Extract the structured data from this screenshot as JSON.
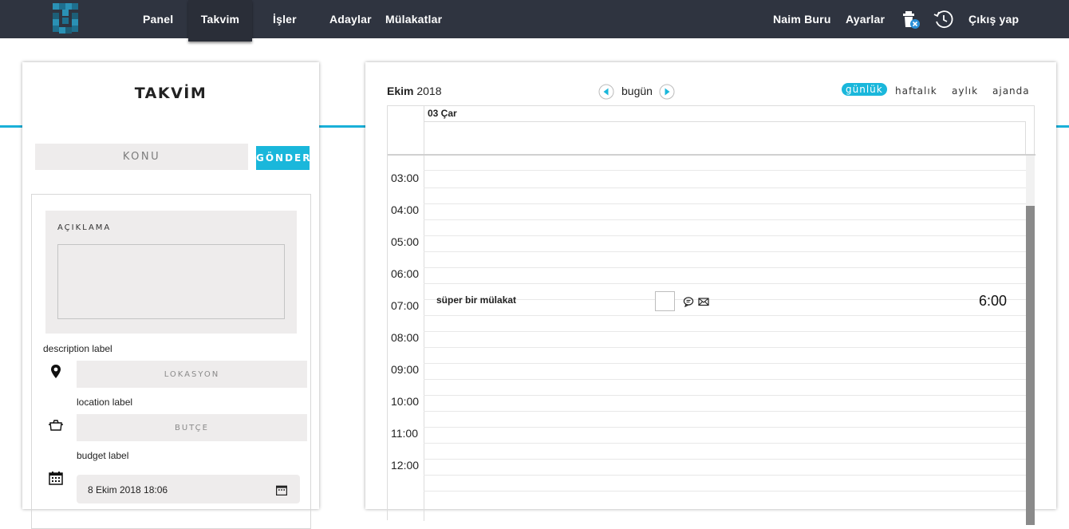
{
  "nav": {
    "items": [
      {
        "label": "Panel"
      },
      {
        "label": "Takvim"
      },
      {
        "label": "İşler"
      },
      {
        "label": "Adaylar"
      },
      {
        "label": "Mülakatlar"
      }
    ],
    "user_name": "Naim Buru",
    "settings_label": "Ayarlar",
    "logout_label": "Çıkış yap",
    "active_item": "Takvim"
  },
  "left": {
    "title": "TAKVİM",
    "subject_placeholder": "KONU",
    "send_label": "GÖNDER",
    "description_heading": "AÇIKLAMA",
    "description_label": "description label",
    "location_placeholder": "LOKASYON",
    "location_label": "location label",
    "budget_placeholder": "BÜTÇE",
    "budget_label": "budget label",
    "date_value": "8 Ekim 2018 18:06"
  },
  "calendar": {
    "month": "Ekim",
    "year": "2018",
    "today_label": "bugün",
    "views": [
      {
        "label": "günlük",
        "active": true
      },
      {
        "label": "haftalık",
        "active": false
      },
      {
        "label": "aylık",
        "active": false
      },
      {
        "label": "ajanda",
        "active": false
      }
    ],
    "day_header": "03 Çar",
    "hours": [
      "03:00",
      "04:00",
      "05:00",
      "06:00",
      "07:00",
      "08:00",
      "09:00",
      "10:00",
      "11:00",
      "12:00"
    ],
    "event": {
      "title": "süper bir mülakat",
      "time": "6:00"
    }
  },
  "colors": {
    "topbar": "#2f3440",
    "accent": "#1ab7db",
    "field_bg": "#eeecec"
  }
}
